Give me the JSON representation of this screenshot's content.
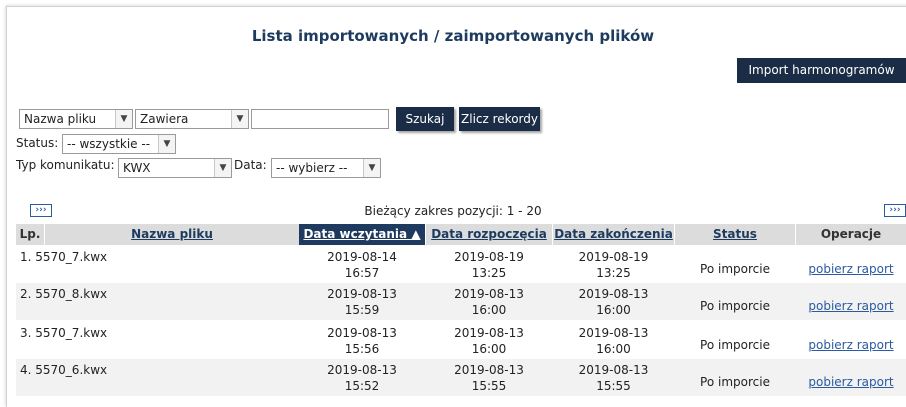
{
  "page": {
    "title": "Lista importowanych / zaimportowanych plików"
  },
  "import_button": {
    "label": "Import harmonogramów"
  },
  "filters": {
    "field_select": "Nazwa pliku",
    "condition_select": "Zawiera",
    "search_value": "",
    "search_button": "Szukaj",
    "count_button": "Zlicz rekordy",
    "status_label": "Status:",
    "status_select": "-- wszystkie --",
    "type_label": "Typ komunikatu:",
    "type_select": "KWX",
    "date_label": "Data:",
    "date_select": "-- wybierz --"
  },
  "pager": {
    "prev_icon": "›››",
    "next_icon": "›››",
    "range_text": "Bieżący zakres pozycji: 1 - 20"
  },
  "table": {
    "headers": {
      "lp": "Lp.",
      "name": "Nazwa pliku",
      "load_date": "Data wczytania ▲",
      "start_date": "Data rozpoczęcia",
      "end_date": "Data zakończenia",
      "status": "Status",
      "ops": "Operacje"
    },
    "rows": [
      {
        "name": "1. 5570_7.kwx",
        "load_d": "2019-08-14",
        "load_t": "16:57",
        "start_d": "2019-08-19",
        "start_t": "13:25",
        "end_d": "2019-08-19",
        "end_t": "13:25",
        "status": "Po imporcie",
        "op": "pobierz raport"
      },
      {
        "name": "2. 5570_8.kwx",
        "load_d": "2019-08-13",
        "load_t": "15:59",
        "start_d": "2019-08-13",
        "start_t": "16:00",
        "end_d": "2019-08-13",
        "end_t": "16:00",
        "status": "Po imporcie",
        "op": "pobierz raport"
      },
      {
        "name": "3. 5570_7.kwx",
        "load_d": "2019-08-13",
        "load_t": "15:56",
        "start_d": "2019-08-13",
        "start_t": "16:00",
        "end_d": "2019-08-13",
        "end_t": "16:00",
        "status": "Po imporcie",
        "op": "pobierz raport"
      },
      {
        "name": "4. 5570_6.kwx",
        "load_d": "2019-08-13",
        "load_t": "15:52",
        "start_d": "2019-08-13",
        "start_t": "15:55",
        "end_d": "2019-08-13",
        "end_t": "15:55",
        "status": "Po imporcie",
        "op": "pobierz raport"
      }
    ]
  }
}
